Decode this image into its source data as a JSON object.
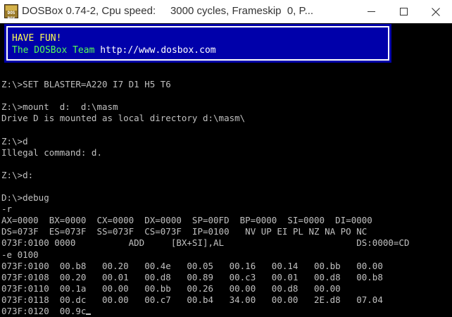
{
  "window": {
    "title": "DOSBox 0.74-2, Cpu speed:     3000 cycles, Frameskip  0, P...",
    "icon_text": "DOS BOX"
  },
  "banner": {
    "line1": "HAVE FUN!",
    "line2_prefix": "The DOSBox Team ",
    "line2_url": "http://www.dosbox.com"
  },
  "console": {
    "lines": [
      "",
      "Z:\\>SET BLASTER=A220 I7 D1 H5 T6",
      "",
      "Z:\\>mount  d:  d:\\masm",
      "Drive D is mounted as local directory d:\\masm\\",
      "",
      "Z:\\>d",
      "Illegal command: d.",
      "",
      "Z:\\>d:",
      "",
      "D:\\>debug",
      "-r",
      "AX=0000  BX=0000  CX=0000  DX=0000  SP=00FD  BP=0000  SI=0000  DI=0000",
      "DS=073F  ES=073F  SS=073F  CS=073F  IP=0100   NV UP EI PL NZ NA PO NC",
      "073F:0100 0000          ADD     [BX+SI],AL                         DS:0000=CD",
      "-e 0100",
      "073F:0100  00.b8   00.20   00.4e   00.05   00.16   00.14   00.bb   00.00",
      "073F:0108  00.20   00.01   00.d8   00.89   00.c3   00.01   00.d8   00.b8",
      "073F:0110  00.1a   00.00   00.bb   00.26   00.00   00.d8   00.00",
      "073F:0118  00.dc   00.00   00.c7   00.b4   34.00   00.00   2E.d8   07.04",
      "073F:0120  00.9c"
    ]
  }
}
